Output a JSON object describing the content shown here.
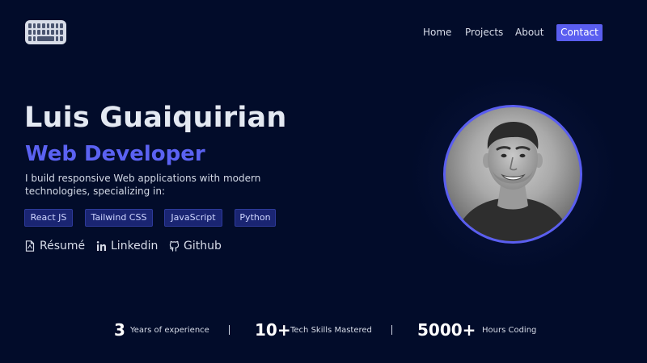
{
  "nav": {
    "logo_icon": "keyboard-icon",
    "items": [
      "Home",
      "Projects",
      "About"
    ],
    "contact_label": "Contact"
  },
  "hero": {
    "name": "Luis Guaiquirian",
    "role": "Web Developer",
    "description": "I build responsive Web applications with modern technologies, specializing in:",
    "tags": [
      "React JS",
      "Tailwind CSS",
      "JavaScript",
      "Python"
    ],
    "links": [
      {
        "label": "Résumé",
        "icon": "document-icon"
      },
      {
        "label": "Linkedin",
        "icon": "linkedin-icon"
      },
      {
        "label": "Github",
        "icon": "github-icon"
      }
    ]
  },
  "stats": [
    {
      "value": "3",
      "label": "Years of experience"
    },
    {
      "value": "10+",
      "label": "Tech Skills Mastered"
    },
    {
      "value": "5000+",
      "label": "Hours Coding"
    }
  ],
  "colors": {
    "background": "#020c2a",
    "accent": "#5a5ef0",
    "tag_background": "#1a2572"
  }
}
